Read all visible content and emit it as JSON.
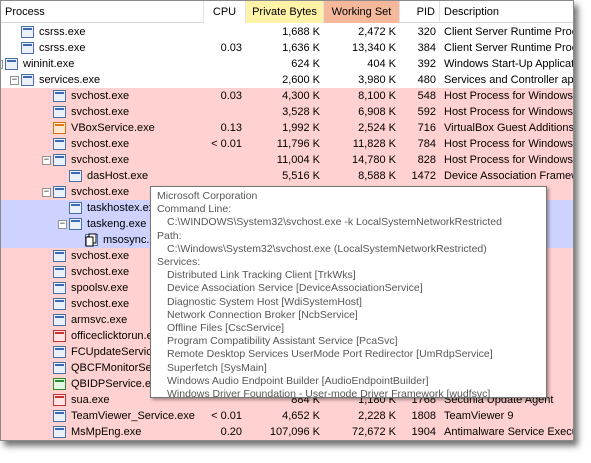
{
  "header": {
    "process": "Process",
    "cpu": "CPU",
    "private_bytes": "Private Bytes",
    "working_set": "Working Set",
    "pid": "PID",
    "description": "Description"
  },
  "rows": [
    {
      "name": "csrss.exe",
      "cpu": "",
      "private_bytes": "1,688 K",
      "working_set": "2,472 K",
      "pid": "320",
      "description": "Client Server Runtime Proc",
      "color": "white",
      "icon": "process-icon",
      "tog": ""
    },
    {
      "name": "csrss.exe",
      "cpu": "0.03",
      "private_bytes": "1,636 K",
      "working_set": "13,340 K",
      "pid": "384",
      "description": "Client Server Runtime Proc",
      "color": "white",
      "icon": "process-icon",
      "tog": ""
    },
    {
      "name": "wininit.exe",
      "cpu": "",
      "private_bytes": "624 K",
      "working_set": "404 K",
      "pid": "392",
      "description": "Windows Start-Up Applicati",
      "color": "white",
      "icon": "process-icon",
      "tog": "−"
    },
    {
      "name": "services.exe",
      "cpu": "",
      "private_bytes": "2,600 K",
      "working_set": "3,980 K",
      "pid": "480",
      "description": "Services and Controller ap",
      "color": "white",
      "icon": "process-icon",
      "tog": "−"
    },
    {
      "name": "svchost.exe",
      "cpu": "0.03",
      "private_bytes": "4,300 K",
      "working_set": "8,100 K",
      "pid": "548",
      "description": "Host Process for Windows",
      "color": "pink",
      "icon": "process-icon",
      "tog": ""
    },
    {
      "name": "svchost.exe",
      "cpu": "",
      "private_bytes": "3,528 K",
      "working_set": "6,908 K",
      "pid": "592",
      "description": "Host Process for Windows",
      "color": "pink",
      "icon": "process-icon",
      "tog": ""
    },
    {
      "name": "VBoxService.exe",
      "cpu": "0.13",
      "private_bytes": "1,992 K",
      "working_set": "2,524 K",
      "pid": "716",
      "description": "VirtualBox Guest Additions",
      "color": "pink",
      "icon": "vbox-icon",
      "tog": ""
    },
    {
      "name": "svchost.exe",
      "cpu": "< 0.01",
      "private_bytes": "11,796 K",
      "working_set": "11,828 K",
      "pid": "784",
      "description": "Host Process for Windows",
      "color": "pink",
      "icon": "process-icon",
      "tog": ""
    },
    {
      "name": "svchost.exe",
      "cpu": "",
      "private_bytes": "11,004 K",
      "working_set": "14,780 K",
      "pid": "828",
      "description": "Host Process for Windows",
      "color": "pink",
      "icon": "process-icon",
      "tog": "−"
    },
    {
      "name": "dasHost.exe",
      "cpu": "",
      "private_bytes": "5,516 K",
      "working_set": "8,588 K",
      "pid": "1472",
      "description": "Device Association Framew",
      "color": "pink",
      "icon": "process-icon",
      "tog": ""
    },
    {
      "name": "svchost.exe",
      "cpu": "",
      "private_bytes": "",
      "working_set": "",
      "pid": "",
      "description": "Windows",
      "color": "pink",
      "icon": "process-icon",
      "tog": "−"
    },
    {
      "name": "taskhostex.exe",
      "cpu": "",
      "private_bytes": "",
      "working_set": "",
      "pid": "",
      "description": "",
      "color": "blue",
      "icon": "process-icon",
      "tog": ""
    },
    {
      "name": "taskeng.exe",
      "cpu": "",
      "private_bytes": "",
      "working_set": "",
      "pid": "",
      "description": "Engine",
      "color": "blue",
      "icon": "process-icon",
      "tog": "−"
    },
    {
      "name": "msosync.ex",
      "cpu": "",
      "private_bytes": "",
      "working_set": "",
      "pid": "",
      "description": "Document",
      "color": "blue",
      "icon": "process-icon",
      "tog": ""
    },
    {
      "name": "svchost.exe",
      "cpu": "",
      "private_bytes": "",
      "working_set": "",
      "pid": "",
      "description": "Windows",
      "color": "pink",
      "icon": "process-icon",
      "tog": ""
    },
    {
      "name": "svchost.exe",
      "cpu": "",
      "private_bytes": "",
      "working_set": "",
      "pid": "",
      "description": "Windows",
      "color": "pink",
      "icon": "process-icon",
      "tog": ""
    },
    {
      "name": "spoolsv.exe",
      "cpu": "",
      "private_bytes": "",
      "working_set": "",
      "pid": "",
      "description": "em App",
      "color": "pink",
      "icon": "printer-icon",
      "tog": ""
    },
    {
      "name": "svchost.exe",
      "cpu": "",
      "private_bytes": "",
      "working_set": "",
      "pid": "",
      "description": "Windows",
      "color": "pink",
      "icon": "process-icon",
      "tog": ""
    },
    {
      "name": "armsvc.exe",
      "cpu": "",
      "private_bytes": "",
      "working_set": "",
      "pid": "",
      "description": "pdate Ser",
      "color": "pink",
      "icon": "process-icon",
      "tog": ""
    },
    {
      "name": "officeclicktorun.ex",
      "cpu": "",
      "private_bytes": "",
      "working_set": "",
      "pid": "",
      "description": "Click-to-Ru",
      "color": "pink",
      "icon": "office-icon",
      "tog": ""
    },
    {
      "name": "FCUpdateService",
      "cpu": "",
      "private_bytes": "",
      "working_set": "",
      "pid": "",
      "description": "Update Se",
      "color": "pink",
      "icon": "process-icon",
      "tog": ""
    },
    {
      "name": "QBCFMonitorSer",
      "cpu": "",
      "private_bytes": "",
      "working_set": "",
      "pid": "",
      "description": "pany File",
      "color": "pink",
      "icon": "process-icon",
      "tog": ""
    },
    {
      "name": "QBIDPService.ex",
      "cpu": "",
      "private_bytes": "",
      "working_set": "",
      "pid": "",
      "description": "",
      "color": "pink",
      "icon": "quickbooks-icon",
      "tog": ""
    },
    {
      "name": "sua.exe",
      "cpu": "",
      "private_bytes": "884 K",
      "working_set": "1,180 K",
      "pid": "1768",
      "description": "Secunia Update Agent",
      "color": "pink",
      "icon": "secunia-icon",
      "tog": ""
    },
    {
      "name": "TeamViewer_Service.exe",
      "cpu": "< 0.01",
      "private_bytes": "4,652 K",
      "working_set": "2,228 K",
      "pid": "1808",
      "description": "TeamViewer 9",
      "color": "pink",
      "icon": "teamviewer-icon",
      "tog": ""
    },
    {
      "name": "MsMpEng.exe",
      "cpu": "0.20",
      "private_bytes": "107,096 K",
      "working_set": "72,672 K",
      "pid": "1904",
      "description": "Antimalware Service Execu",
      "color": "pink",
      "icon": "process-icon",
      "tog": ""
    }
  ],
  "tooltip": {
    "company": "Microsoft Corporation",
    "cmd_label": "Command Line:",
    "cmd_value": "C:\\WINDOWS\\System32\\svchost.exe -k LocalSystemNetworkRestricted",
    "path_label": "Path:",
    "path_value": "C:\\Windows\\System32\\svchost.exe (LocalSystemNetworkRestricted)",
    "services_label": "Services:",
    "services": [
      "Distributed Link Tracking Client [TrkWks]",
      "Device Association Service [DeviceAssociationService]",
      "Diagnostic System Host [WdiSystemHost]",
      "Network Connection Broker [NcbService]",
      "Offline Files [CscService]",
      "Program Compatibility Assistant Service [PcaSvc]",
      "Remote Desktop Services UserMode Port Redirector [UmRdpService]",
      "Superfetch [SysMain]",
      "Windows Audio Endpoint Builder [AudioEndpointBuilder]",
      "Windows Driver Foundation - User-mode Driver Framework [wudfsvc]"
    ]
  },
  "colors": {
    "service_row": "#ffd1d1",
    "own_process_row": "#cdd2ff",
    "private_bytes_header": "#fff3a8",
    "working_set_header": "#f6b89b"
  }
}
